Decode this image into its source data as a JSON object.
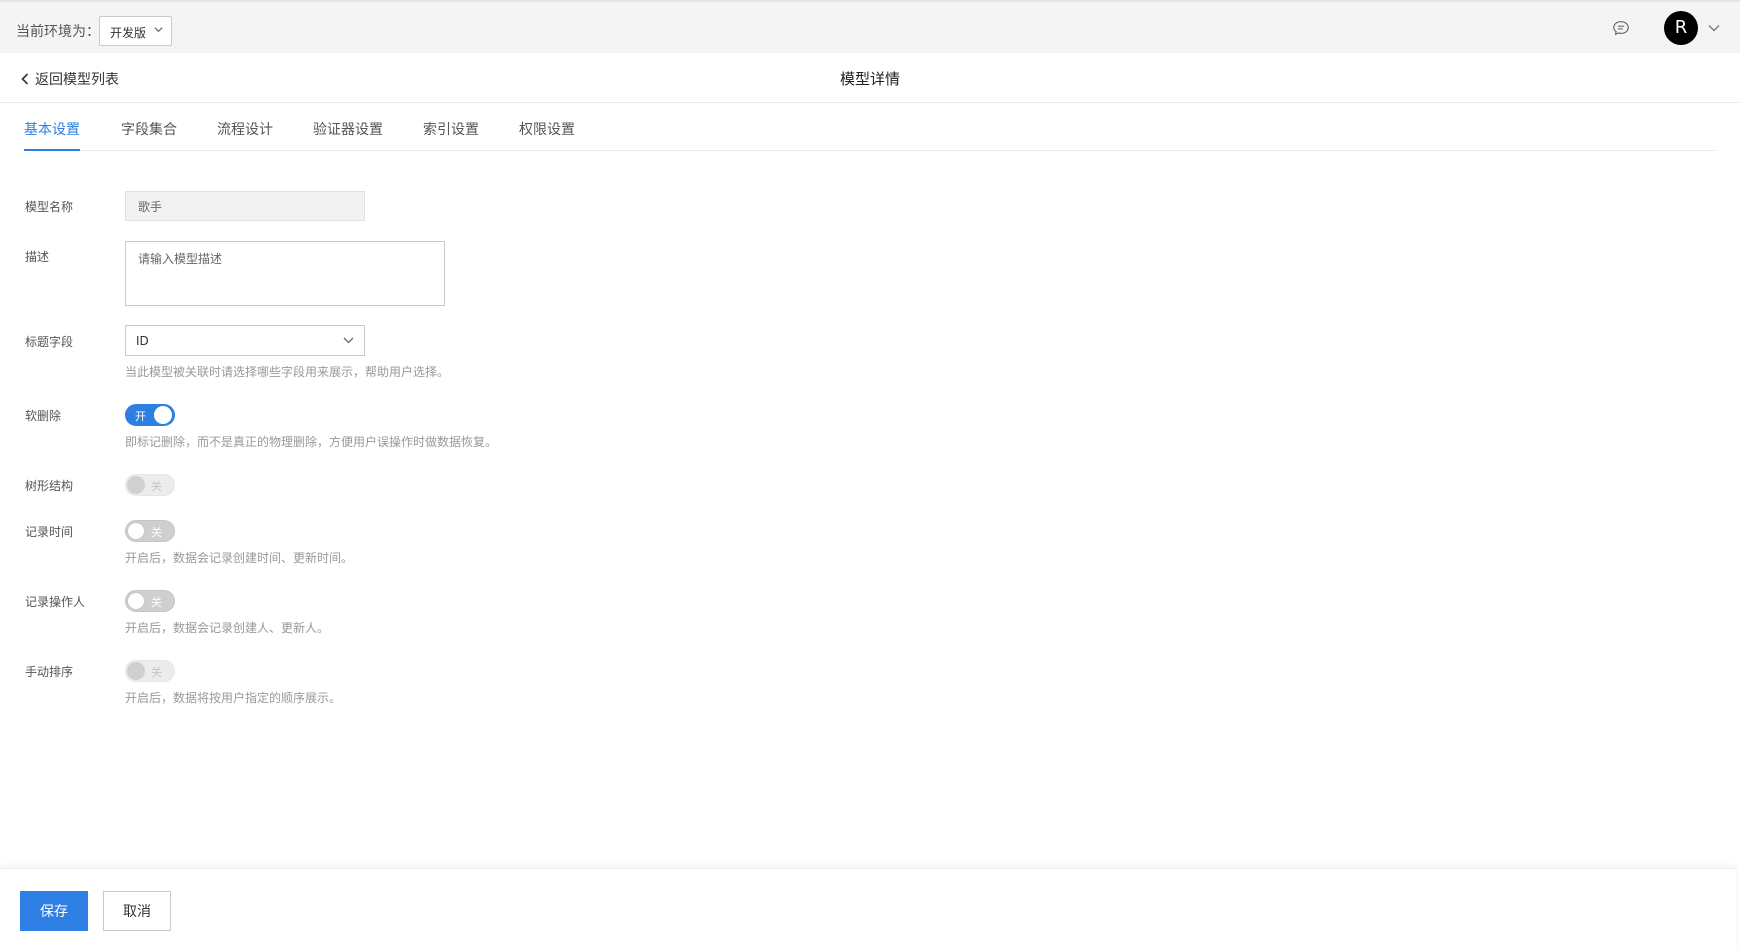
{
  "header": {
    "env_label": "当前环境为：",
    "env_value": "开发版",
    "avatar_letter": "R"
  },
  "pagehead": {
    "back_label": "返回模型列表",
    "title": "模型详情"
  },
  "tabs": [
    {
      "label": "基本设置",
      "active": true
    },
    {
      "label": "字段集合",
      "active": false
    },
    {
      "label": "流程设计",
      "active": false
    },
    {
      "label": "验证器设置",
      "active": false
    },
    {
      "label": "索引设置",
      "active": false
    },
    {
      "label": "权限设置",
      "active": false
    }
  ],
  "form": {
    "name": {
      "label": "模型名称",
      "value": "歌手"
    },
    "description": {
      "label": "描述",
      "placeholder": "请输入模型描述"
    },
    "title_field": {
      "label": "标题字段",
      "value": "ID",
      "hint": "当此模型被关联时请选择哪些字段用来展示，帮助用户选择。"
    },
    "soft_delete": {
      "label": "软删除",
      "state": "开",
      "on": true,
      "hint": "即标记删除，而不是真正的物理删除，方便用户误操作时做数据恢复。"
    },
    "tree": {
      "label": "树形结构",
      "state": "关",
      "on": false,
      "disabled": true
    },
    "record_time": {
      "label": "记录时间",
      "state": "关",
      "on": false,
      "hint": "开启后，数据会记录创建时间、更新时间。"
    },
    "record_operator": {
      "label": "记录操作人",
      "state": "关",
      "on": false,
      "hint": "开启后，数据会记录创建人、更新人。"
    },
    "manual_sort": {
      "label": "手动排序",
      "state": "关",
      "on": false,
      "disabled": true,
      "hint": "开启后，数据将按用户指定的顺序展示。"
    }
  },
  "footer": {
    "save_label": "保存",
    "cancel_label": "取消"
  },
  "colors": {
    "accent": "#2d7fe3",
    "topbar_bg": "#f4f4f4"
  },
  "icons": [
    "chevron-down-icon",
    "message-icon",
    "chevron-left-icon"
  ]
}
